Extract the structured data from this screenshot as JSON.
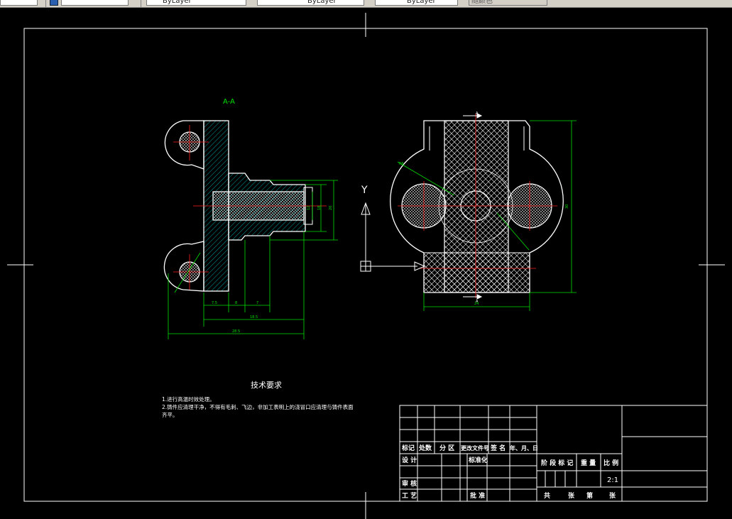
{
  "toolbar": {
    "layer_combo": "",
    "color_combo": "ByLayer",
    "linetype_combo": "ByLayer",
    "lineweight_combo": "ByLayer",
    "plotstyle_combo": "随颜色"
  },
  "drawing": {
    "section_label": "A-A",
    "view_marker_top": "A",
    "view_marker_bottom": "A",
    "ucs_y": "Y",
    "dims": {
      "d1": "7.5",
      "d2": "8",
      "d3": "7",
      "d4": "18.5",
      "d5": "28.5",
      "d6": "12",
      "d7": "18",
      "d8": "20",
      "d9": "30",
      "d10": "24",
      "d11": "R6"
    }
  },
  "notes": {
    "title": "技术要求",
    "line1": "1.进行高温时效处理。",
    "line2": "2.铸件应清理干净，不得有毛刺、飞边，非加工表明上的浇冒口应清理与铸件表面",
    "line3": "齐平。"
  },
  "title_block": {
    "headers": {
      "biaoji": "标记",
      "chushu": "处数",
      "fenqu": "分 区",
      "genggai": "更改文件号",
      "qianming": "签 名",
      "nianyueri": "年、月、日"
    },
    "sheji": "设 计",
    "biaozhunhua": "标准化",
    "jieduan": "阶 段 标 记",
    "zhongliang": "重 量",
    "bili": "比 例",
    "scale": "2:1",
    "shenhe": "审 核",
    "gongyi": "工 艺",
    "pizhun": "批 准",
    "gong": "共",
    "zhang": "张",
    "di": "第",
    "zhang2": "张"
  }
}
